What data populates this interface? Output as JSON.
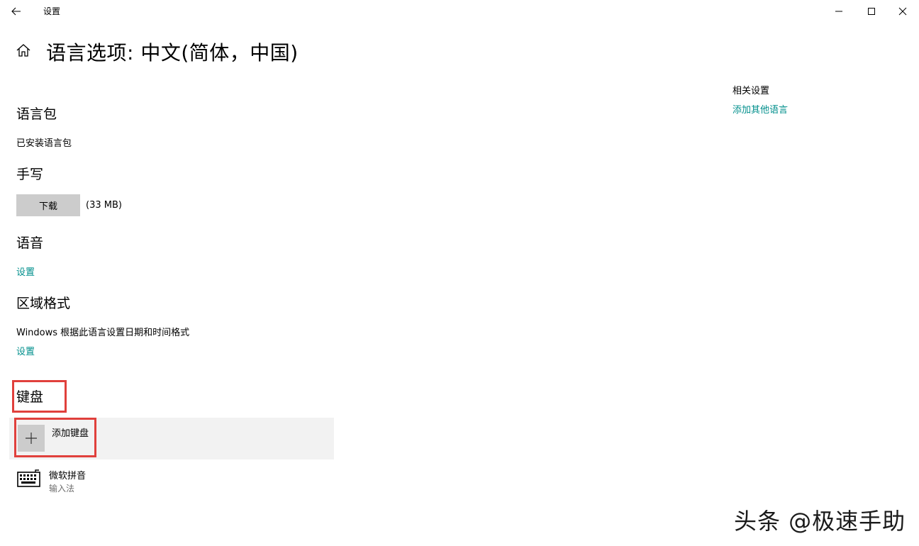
{
  "window": {
    "app_title": "设置",
    "back_icon": "arrow-left-icon",
    "controls": [
      "minimize-icon",
      "maximize-icon",
      "close-icon"
    ]
  },
  "header": {
    "home_icon": "home-icon",
    "title": "语言选项: 中文(简体，中国)"
  },
  "related": {
    "heading": "相关设置",
    "add_language_link": "添加其他语言"
  },
  "language_pack": {
    "heading": "语言包",
    "status": "已安装语言包"
  },
  "handwriting": {
    "heading": "手写",
    "download_button": "下载",
    "size": "(33 MB)"
  },
  "speech": {
    "heading": "语音",
    "settings_link": "设置"
  },
  "regional_format": {
    "heading": "区域格式",
    "description": "Windows 根据此语言设置日期和时间格式",
    "settings_link": "设置"
  },
  "keyboard": {
    "heading": "键盘",
    "add_label": "添加键盘",
    "add_icon": "plus-icon",
    "items": [
      {
        "name": "微软拼音",
        "type": "输入法",
        "icon": "keyboard-icon"
      }
    ]
  },
  "highlight_color": "#e0403c",
  "accent_color": "#008f8c",
  "watermark": "头条 @极速手助"
}
